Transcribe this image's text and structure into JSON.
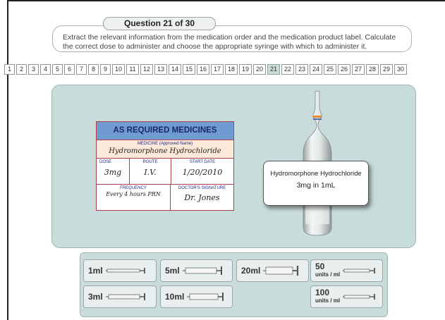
{
  "question": {
    "title": "Question 21 of 30",
    "instructions": "Extract the relevant information from the medication order and the medication product label. Calculate the correct dose to administer and choose the appropriate syringe with which to administer it."
  },
  "question_numbers": [
    "1",
    "2",
    "3",
    "4",
    "5",
    "6",
    "7",
    "8",
    "9",
    "10",
    "11",
    "12",
    "13",
    "14",
    "15",
    "16",
    "17",
    "18",
    "19",
    "20",
    "21",
    "22",
    "23",
    "24",
    "25",
    "26",
    "27",
    "28",
    "29",
    "30"
  ],
  "active_question": "21",
  "med_chart": {
    "heading": "AS REQUIRED MEDICINES",
    "medicine_label": "MEDICINE (Approved Name)",
    "medicine": "Hydromorphone Hydrochloride",
    "dose_label": "DOSE",
    "dose": "3mg",
    "route_label": "ROUTE",
    "route": "I.V.",
    "start_label": "START DATE",
    "start_date": "1/20/2010",
    "frequency_label": "FREQUENCY",
    "frequency": "Every 4 hours PRN",
    "signature_label": "DOCTOR'S SIGNATURE",
    "signature": "Dr. Jones"
  },
  "product_label": {
    "name": "Hydromorphone Hydrochloride",
    "strength": "3mg in 1mL"
  },
  "syringes": {
    "s1ml": "1ml",
    "s3ml": "3ml",
    "s5ml": "5ml",
    "s10ml": "10ml",
    "s20ml": "20ml",
    "s50_num": "50",
    "s50_unit": "units / ml",
    "s100_num": "100",
    "s100_unit": "units / ml"
  },
  "colors": {
    "stage_bg": "#c9dcdc",
    "chart_header": "#6f9bd1",
    "chart_border": "#b04050",
    "active_question": "#c9dcd8"
  }
}
